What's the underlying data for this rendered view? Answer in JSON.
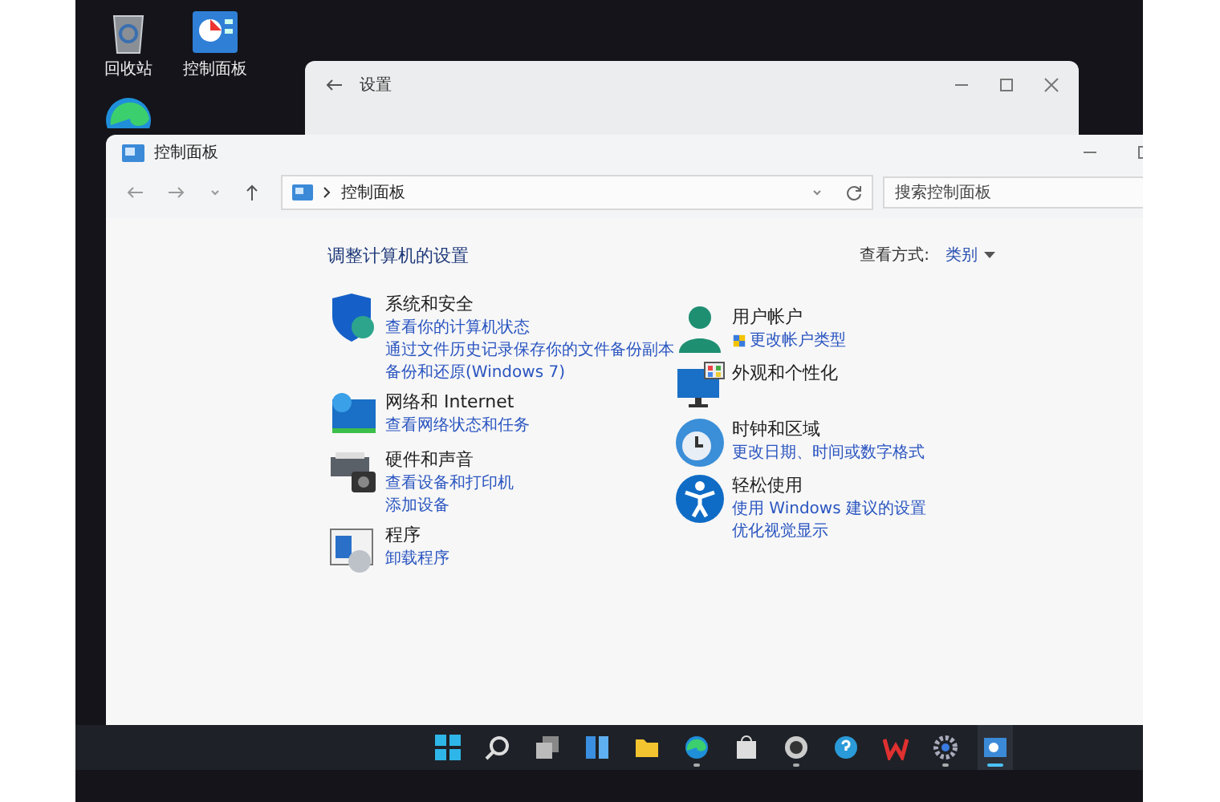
{
  "desktop_icons": [
    {
      "label": "回收站",
      "kind": "recycle"
    },
    {
      "label": "控制面板",
      "kind": "control"
    },
    {
      "kind": "edge"
    }
  ],
  "settings_window": {
    "title": "设置"
  },
  "window": {
    "title": "控制面板",
    "breadcrumb": "控制面板",
    "search": {
      "placeholder": "搜索控制面板"
    }
  },
  "heading": "调整计算机的设置",
  "view_by": {
    "label": "查看方式:",
    "value": "类别"
  },
  "left_column": [
    {
      "title": "系统和安全",
      "kind": "shield",
      "links": [
        "查看你的计算机状态",
        "通过文件历史记录保存你的文件备份副本",
        "备份和还原(Windows 7)"
      ]
    },
    {
      "title": "网络和 Internet",
      "kind": "network",
      "links": [
        "查看网络状态和任务"
      ]
    },
    {
      "title": "硬件和声音",
      "kind": "printer",
      "links": [
        "查看设备和打印机",
        "添加设备"
      ]
    },
    {
      "title": "程序",
      "kind": "programs",
      "links": [
        "卸载程序"
      ]
    }
  ],
  "right_column": [
    {
      "title": "用户帐户",
      "kind": "user",
      "links": [
        "更改帐户类型"
      ]
    },
    {
      "title": "外观和个性化",
      "kind": "appearance"
    },
    {
      "title": "时钟和区域",
      "kind": "clock",
      "links": [
        "更改日期、时间或数字格式"
      ]
    },
    {
      "title": "轻松使用",
      "kind": "access",
      "links": [
        "使用 Windows 建议的设置",
        "优化视觉显示"
      ]
    }
  ],
  "taskbar": [
    {
      "kind": "start",
      "running": false,
      "selected": false
    },
    {
      "kind": "search",
      "running": false,
      "selected": false
    },
    {
      "kind": "taskview",
      "running": false,
      "selected": false
    },
    {
      "kind": "widgets",
      "running": false,
      "selected": false
    },
    {
      "kind": "folder",
      "running": false,
      "selected": false
    },
    {
      "kind": "edge",
      "running": true,
      "selected": false
    },
    {
      "kind": "store",
      "running": false,
      "selected": false
    },
    {
      "kind": "circle",
      "running": true,
      "selected": false
    },
    {
      "kind": "help",
      "running": false,
      "selected": false
    },
    {
      "kind": "wps",
      "running": false,
      "selected": false
    },
    {
      "kind": "gear",
      "running": true,
      "selected": false
    },
    {
      "kind": "control",
      "running": true,
      "selected": true
    }
  ]
}
